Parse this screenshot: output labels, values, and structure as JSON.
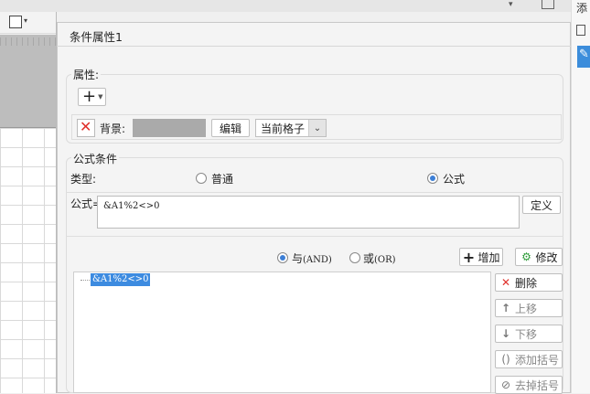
{
  "background_app": {
    "right_panel_title": "添"
  },
  "dialog": {
    "title": "条件属性1",
    "attributes": {
      "group_label": "属性:",
      "add_button": "+",
      "background_label": "背景:",
      "background_swatch_color": "#aaaaaa",
      "edit_button": "编辑",
      "scope_select_value": "当前格子"
    },
    "formula_condition": {
      "group_label": "公式条件",
      "type_label": "类型:",
      "type_options": [
        {
          "label": "普通",
          "selected": false
        },
        {
          "label": "公式",
          "selected": true
        }
      ],
      "formula_label": "公式=",
      "formula_value": "&A1%2<>0",
      "define_button": "定义",
      "logic_options": [
        {
          "label": "与",
          "sub": "(AND)",
          "selected": true
        },
        {
          "label": "或",
          "sub": "(OR)",
          "selected": false
        }
      ],
      "add_button": "增加",
      "modify_button": "修改",
      "conditions": [
        "&A1%2<>0"
      ],
      "side_buttons": {
        "delete": "删除",
        "move_up": "上移",
        "move_down": "下移",
        "add_bracket": "添加括号",
        "remove_bracket": "去掉括号"
      }
    }
  },
  "colors": {
    "accent": "#3d8be0",
    "delete_red": "#e0302b",
    "modify_green": "#2e9c3a"
  }
}
